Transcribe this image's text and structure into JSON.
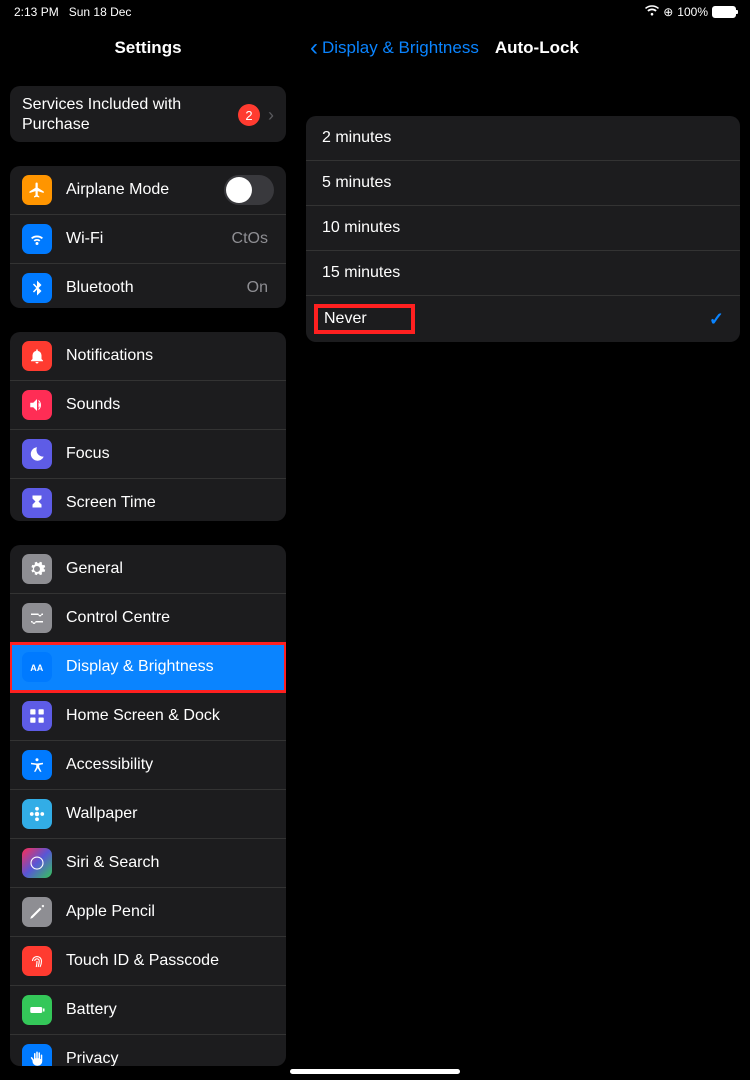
{
  "status": {
    "time": "2:13 PM",
    "date": "Sun 18 Dec",
    "battery": "100%"
  },
  "sidebar": {
    "title": "Settings",
    "group0": {
      "services": "Services Included with Purchase",
      "badge": "2"
    },
    "group1": {
      "airplane": "Airplane Mode",
      "wifi": "Wi-Fi",
      "wifi_value": "CtOs",
      "bluetooth": "Bluetooth",
      "bluetooth_value": "On"
    },
    "group2": {
      "notifications": "Notifications",
      "sounds": "Sounds",
      "focus": "Focus",
      "screentime": "Screen Time"
    },
    "group3": {
      "general": "General",
      "controlcentre": "Control Centre",
      "display": "Display & Brightness",
      "homescreen": "Home Screen & Dock",
      "accessibility": "Accessibility",
      "wallpaper": "Wallpaper",
      "siri": "Siri & Search",
      "pencil": "Apple Pencil",
      "touchid": "Touch ID & Passcode",
      "battery": "Battery",
      "privacy": "Privacy"
    }
  },
  "detail": {
    "back": "Display & Brightness",
    "title": "Auto-Lock",
    "options": {
      "o1": "2 minutes",
      "o2": "5 minutes",
      "o3": "10 minutes",
      "o4": "15 minutes",
      "o5": "Never"
    }
  }
}
